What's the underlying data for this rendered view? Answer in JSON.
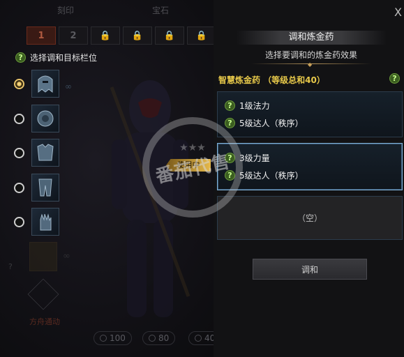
{
  "close_label": "X",
  "top_tabs": [
    "刻印",
    "宝石"
  ],
  "slot_tabs": [
    "1",
    "2"
  ],
  "left": {
    "header_label": "选择调和目标栏位",
    "slots": [
      {
        "item": "helmet-icon",
        "checked": true
      },
      {
        "item": "shoulder-armor-icon",
        "checked": false
      },
      {
        "item": "chest-armor-icon",
        "checked": false
      },
      {
        "item": "leg-armor-icon",
        "checked": false
      },
      {
        "item": "gauntlet-icon",
        "checked": false
      }
    ],
    "emblem_label": "方舟通动",
    "stats": [
      "100",
      "80",
      "40"
    ]
  },
  "panel": {
    "title": "调和炼金药",
    "subtitle": "选择要调和的炼金药效果",
    "potion_title": "智慧炼金药 （等级总和40）",
    "in_use_label": "使用中",
    "effects": [
      {
        "lines": [
          "1级法力",
          "5级达人（秩序）"
        ],
        "active": false
      },
      {
        "lines": [
          "3级力量",
          "5级达人（秩序）"
        ],
        "active": true
      }
    ],
    "empty_label": "（空）",
    "mix_button": "调和"
  },
  "watermark": "番茄代售",
  "colors": {
    "accent_gold": "#e8c94a",
    "active_border": "#7fb0d6",
    "badge_green": "#3b5e20"
  }
}
